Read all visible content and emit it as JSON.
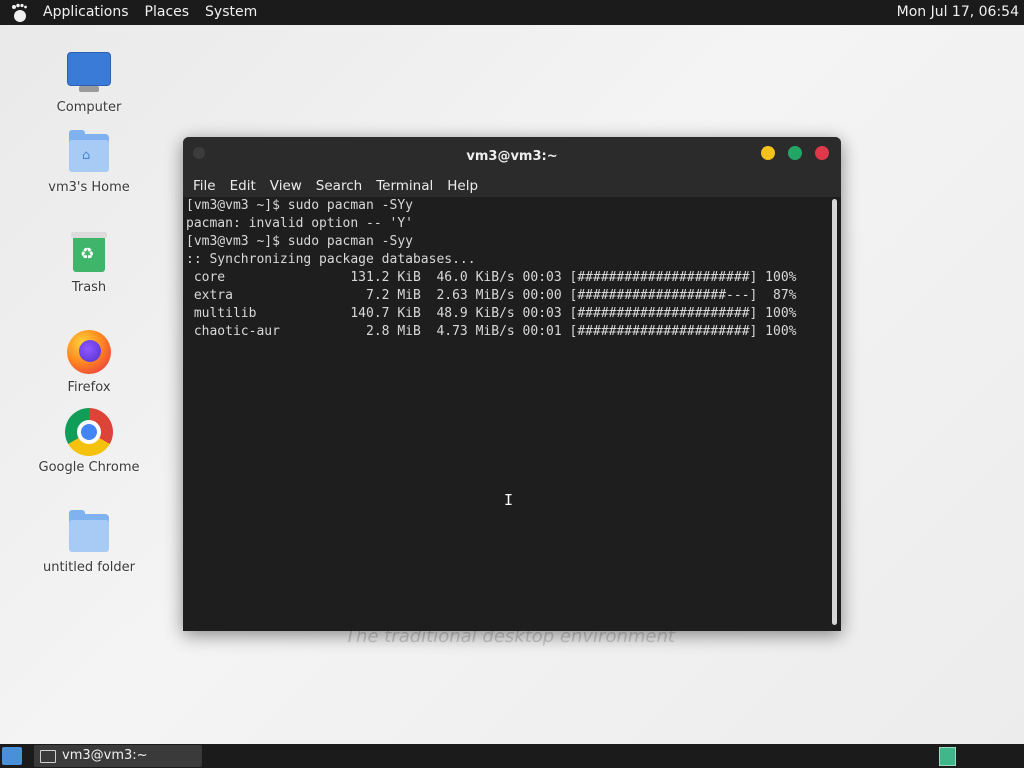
{
  "top_panel": {
    "menus": [
      "Applications",
      "Places",
      "System"
    ],
    "clock": "Mon Jul 17, 06:54"
  },
  "desktop": {
    "icons": [
      {
        "label": "Computer",
        "icon": "computer-icon"
      },
      {
        "label": "vm3's Home",
        "icon": "home-folder-icon"
      },
      {
        "label": "Trash",
        "icon": "trash-icon"
      },
      {
        "label": "Firefox",
        "icon": "firefox-icon"
      },
      {
        "label": "Google Chrome",
        "icon": "chrome-icon"
      },
      {
        "label": "untitled folder",
        "icon": "folder-icon"
      }
    ],
    "tagline": "The traditional desktop environment"
  },
  "terminal": {
    "title": "vm3@vm3:~",
    "menus": [
      "File",
      "Edit",
      "View",
      "Search",
      "Terminal",
      "Help"
    ],
    "lines": [
      "[vm3@vm3 ~]$ sudo pacman -SYy",
      "pacman: invalid option -- 'Y'",
      "[vm3@vm3 ~]$ sudo pacman -Syy",
      ":: Synchronizing package databases...",
      " core                131.2 KiB  46.0 KiB/s 00:03 [######################] 100%",
      " extra                 7.2 MiB  2.63 MiB/s 00:00 [###################---]  87%",
      " multilib            140.7 KiB  48.9 KiB/s 00:03 [######################] 100%",
      " chaotic-aur           2.8 MiB  4.73 MiB/s 00:01 [######################] 100%"
    ]
  },
  "taskbar": {
    "items": [
      {
        "label": "vm3@vm3:~"
      }
    ]
  },
  "colors": {
    "panel": "#1b1b1b",
    "terminal_bg": "#1e1e1e",
    "close": "#e0384b",
    "minimize": "#f5c21d",
    "maximize": "#23a566"
  }
}
